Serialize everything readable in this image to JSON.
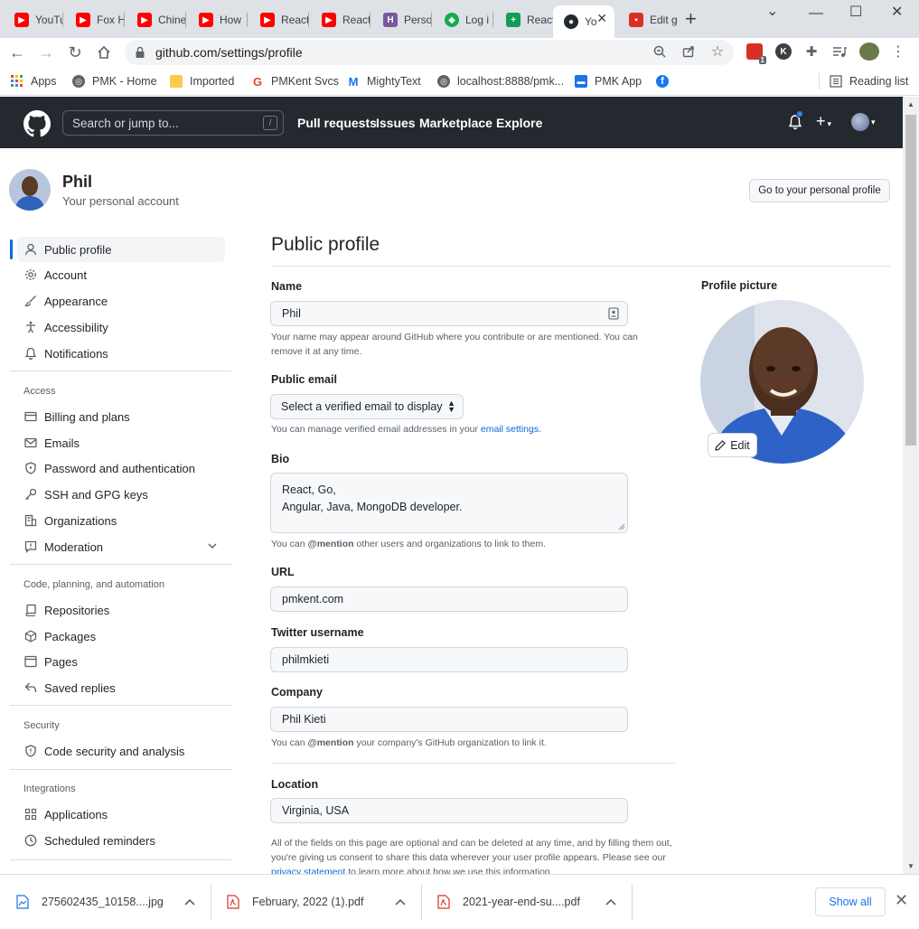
{
  "browser": {
    "tabs": [
      {
        "label": "YouTube",
        "icon": "youtube-icon",
        "color": "#ff0000"
      },
      {
        "label": "Fox H",
        "icon": "youtube-icon",
        "color": "#ff0000"
      },
      {
        "label": "Chine",
        "icon": "youtube-icon",
        "color": "#ff0000"
      },
      {
        "label": "How",
        "icon": "youtube-icon",
        "color": "#ff0000"
      },
      {
        "label": "React",
        "icon": "youtube-icon",
        "color": "#ff0000"
      },
      {
        "label": "React",
        "icon": "youtube-icon",
        "color": "#ff0000"
      },
      {
        "label": "Perso",
        "icon": "heroku-icon",
        "color": "#79589f"
      },
      {
        "label": "Log i",
        "icon": "mongodb-icon",
        "color": "#13aa52"
      },
      {
        "label": "React",
        "icon": "sheets-icon",
        "color": "#0f9d58"
      },
      {
        "label": "Yo",
        "icon": "github-icon",
        "color": "#24292f"
      },
      {
        "label": "Edit g",
        "icon": "app-icon",
        "color": "#d93025"
      }
    ],
    "url": "github.com/settings/profile",
    "extension_badge": "1",
    "extension_letter": "K",
    "bookmarks": [
      {
        "label": "Apps",
        "icon": "apps-grid-icon"
      },
      {
        "label": "PMK - Home",
        "icon": "globe-icon"
      },
      {
        "label": "Imported",
        "icon": "folder-icon"
      },
      {
        "label": "PMKent Svcs",
        "icon": "google-icon"
      },
      {
        "label": "MightyText",
        "icon": "mightytext-icon"
      },
      {
        "label": "localhost:8888/pmk...",
        "icon": "globe-icon"
      },
      {
        "label": "PMK App",
        "icon": "pmk-app-icon"
      },
      {
        "label": "",
        "icon": "facebook-icon"
      }
    ],
    "reading_list": "Reading list"
  },
  "gh_header": {
    "search_placeholder": "Search or jump to...",
    "search_key": "/",
    "nav": [
      "Pull requests",
      "Issues",
      "Marketplace",
      "Explore"
    ]
  },
  "account": {
    "name": "Phil",
    "subtitle": "Your personal account",
    "profile_button": "Go to your personal profile"
  },
  "sidebar": {
    "top": [
      {
        "label": "Public profile",
        "icon": "person-icon"
      },
      {
        "label": "Account",
        "icon": "gear-icon"
      },
      {
        "label": "Appearance",
        "icon": "paintbrush-icon"
      },
      {
        "label": "Accessibility",
        "icon": "accessibility-icon"
      },
      {
        "label": "Notifications",
        "icon": "bell-icon"
      }
    ],
    "access_heading": "Access",
    "access": [
      {
        "label": "Billing and plans",
        "icon": "credit-card-icon"
      },
      {
        "label": "Emails",
        "icon": "mail-icon"
      },
      {
        "label": "Password and authentication",
        "icon": "shield-lock-icon"
      },
      {
        "label": "SSH and GPG keys",
        "icon": "key-icon"
      },
      {
        "label": "Organizations",
        "icon": "organization-icon"
      },
      {
        "label": "Moderation",
        "icon": "report-icon"
      }
    ],
    "code_heading": "Code, planning, and automation",
    "code": [
      {
        "label": "Repositories",
        "icon": "repo-icon"
      },
      {
        "label": "Packages",
        "icon": "package-icon"
      },
      {
        "label": "Pages",
        "icon": "browser-icon"
      },
      {
        "label": "Saved replies",
        "icon": "reply-icon"
      }
    ],
    "security_heading": "Security",
    "security": [
      {
        "label": "Code security and analysis",
        "icon": "shield-icon"
      }
    ],
    "integrations_heading": "Integrations",
    "integrations": [
      {
        "label": "Applications",
        "icon": "apps-icon"
      },
      {
        "label": "Scheduled reminders",
        "icon": "clock-icon"
      }
    ]
  },
  "main": {
    "title": "Public profile",
    "name_label": "Name",
    "name_value": "Phil",
    "name_note": "Your name may appear around GitHub where you contribute or are mentioned. You can remove it at any time.",
    "email_label": "Public email",
    "email_select": "Select a verified email to display",
    "email_note_pre": "You can manage verified email addresses in your ",
    "email_note_link": "email settings",
    "email_note_post": ".",
    "bio_label": "Bio",
    "bio_line1": "React, Go,",
    "bio_line2": "Angular, Java, MongoDB developer.",
    "bio_note_pre": "You can ",
    "bio_note_mention": "@mention",
    "bio_note_post": " other users and organizations to link to them.",
    "url_label": "URL",
    "url_value": "pmkent.com",
    "twitter_label": "Twitter username",
    "twitter_value": "philmkieti",
    "company_label": "Company",
    "company_value": "Phil Kieti",
    "company_note_pre": "You can ",
    "company_note_mention": "@mention",
    "company_note_post": " your company's GitHub organization to link it.",
    "location_label": "Location",
    "location_value": "Virginia, USA",
    "footer_note_pre": "All of the fields on this page are optional and can be deleted at any time, and by filling them out, you're giving us consent to share this data wherever your user profile appears. Please see our ",
    "footer_note_link": "privacy statement",
    "footer_note_post": " to learn more about how we use this information.",
    "picture_label": "Profile picture",
    "edit_label": "Edit"
  },
  "downloads": {
    "items": [
      {
        "name": "275602435_10158....jpg",
        "icon": "image-file-icon"
      },
      {
        "name": "February, 2022 (1).pdf",
        "icon": "pdf-file-icon"
      },
      {
        "name": "2021-year-end-su....pdf",
        "icon": "pdf-file-icon"
      }
    ],
    "show_all": "Show all"
  },
  "colors": {
    "github_header": "#24292f",
    "link": "#0969da",
    "active_bar": "#0969da"
  }
}
